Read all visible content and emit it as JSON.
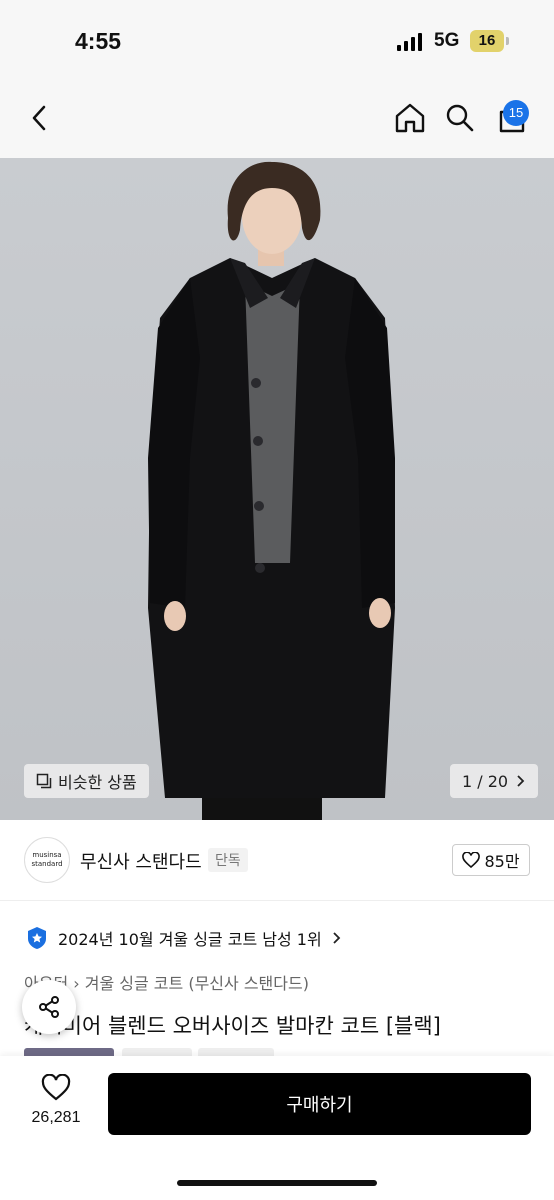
{
  "status_bar": {
    "time": "4:55",
    "network": "5G",
    "battery": "16"
  },
  "nav": {
    "cart_count": "15"
  },
  "gallery": {
    "similar_label": "비슷한 상품",
    "counter": "1 / 20"
  },
  "brand": {
    "logo_line1": "musinsa",
    "logo_line2": "standard",
    "name": "무신사 스탠다드",
    "tag": "단독",
    "likes": "85만"
  },
  "ranking": {
    "text": "2024년 10월 겨울 싱글 코트 남성 1위"
  },
  "breadcrumb": {
    "part1": "아우터",
    "part2": "겨울 싱글 코트 (무신사 스탠다드)"
  },
  "product": {
    "title": "캐시미어 블렌드 오버사이즈 발마칸 코트 [블랙]"
  },
  "bottom": {
    "wish_count": "26,281",
    "buy_label": "구매하기"
  }
}
